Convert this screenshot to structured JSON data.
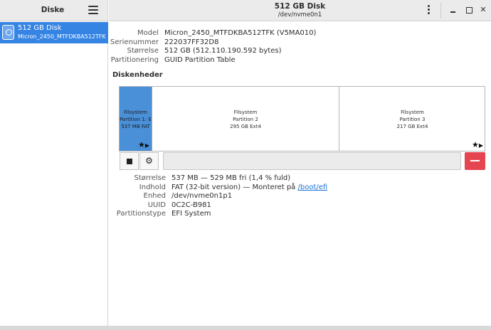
{
  "sidebar": {
    "title": "Diske",
    "disk": {
      "name": "512 GB Disk",
      "model": "Micron_2450_MTFDKBA512TFK"
    }
  },
  "header": {
    "title": "512 GB Disk",
    "subtitle": "/dev/nvme0n1"
  },
  "disk_info": {
    "labels": {
      "model": "Model",
      "serial": "Serienummer",
      "size": "Størrelse",
      "partitioning": "Partitionering"
    },
    "values": {
      "model": "Micron_2450_MTFDKBA512TFK (V5MA010)",
      "serial": "222037FF32D8",
      "size": "512 GB (512.110.190.592 bytes)",
      "partitioning": "GUID Partition Table"
    }
  },
  "volumes_title": "Diskenheder",
  "partitions": [
    {
      "line1": "Filsystem",
      "line2": "Partition 1: E...",
      "line3": "537 MB FAT",
      "selected": true
    },
    {
      "line1": "Filsystem",
      "line2": "Partition 2",
      "line3": "295 GB Ext4",
      "selected": false
    },
    {
      "line1": "Filsystem",
      "line2": "Partition 3",
      "line3": "217 GB Ext4",
      "selected": false
    }
  ],
  "partition_info": {
    "labels": {
      "size": "Størrelse",
      "contents": "Indhold",
      "device": "Enhed",
      "uuid": "UUID",
      "type": "Partitionstype"
    },
    "values": {
      "size": "537 MB — 529 MB fri (1,4 % fuld)",
      "contents_prefix": "FAT (32-bit version) — Monteret på ",
      "contents_link": "/boot/efi",
      "device": "/dev/nvme0n1p1",
      "uuid": "0C2C-B981",
      "type": "EFI System"
    }
  },
  "icons": {
    "menu": "hamburger-menu-icon",
    "more": "kebab-menu-icon",
    "stop": "stop-icon",
    "settings": "gears-icon",
    "delete": "minus-icon",
    "star": "★",
    "play": "▶"
  },
  "colors": {
    "accent": "#3584e4",
    "partition_selected": "#4a90d9",
    "delete": "#e5454f"
  }
}
